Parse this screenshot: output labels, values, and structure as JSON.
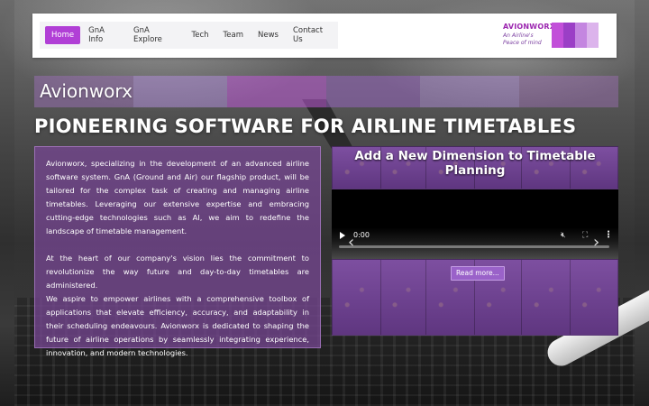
{
  "nav": {
    "items": [
      "Home",
      "GnA Info",
      "GnA Explore",
      "Tech",
      "Team",
      "News",
      "Contact Us"
    ],
    "active_index": 0
  },
  "logo": {
    "name": "AVIONWORX",
    "tagline": "An Airline's Peace of mind"
  },
  "banner": {
    "title": "Avionworx"
  },
  "headline": "PIONEERING SOFTWARE FOR AIRLINE TIMETABLES",
  "about": {
    "paragraph1": "Avionworx, specializing in the development of an advanced airline software system. GnA (Ground and Air) our flagship product, will be tailored for the complex task of creating and managing airline timetables. Leveraging our extensive expertise and embracing cutting-edge technologies such as AI, we aim to redefine the landscape of timetable management.",
    "paragraph2": "At the heart of our company's vision lies the commitment to revolutionize the way future and day-to-day timetables are administered.",
    "paragraph3": "We aspire to empower airlines with a comprehensive toolbox of applications that elevate efficiency, accuracy, and adaptability in their scheduling endeavours. Avionworx is dedicated to shaping the future of airline operations by seamlessly integrating experience, innovation, and modern technologies."
  },
  "video_panel": {
    "title": "Add a New Dimension to Timetable Planning",
    "time": "0:00",
    "read_more": "Read more..."
  },
  "colors": {
    "accent": "#b13fd6",
    "panel": "#7a4a9a"
  }
}
